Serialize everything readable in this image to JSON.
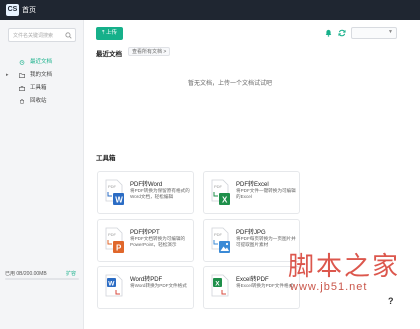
{
  "app": {
    "logo": "CS",
    "title": "首页"
  },
  "sidebar": {
    "search_placeholder": "文件名关键词搜索",
    "items": [
      {
        "label": "最近文档",
        "active": true,
        "icon": "clock-icon"
      },
      {
        "label": "我的文档",
        "active": false,
        "icon": "folder-icon",
        "caret": "▸"
      },
      {
        "label": "工具箱",
        "active": false,
        "icon": "toolbox-icon"
      },
      {
        "label": "回收站",
        "active": false,
        "icon": "trash-icon"
      }
    ],
    "storage_text": "已用 0B/200.00MB",
    "storage_fraction": 0.0,
    "expand_label": "扩容"
  },
  "toolbar": {
    "upload_label": "上传"
  },
  "recent": {
    "title": "最近文档",
    "view_all": "查看所有文档 >",
    "empty_message": "暂无文档，上传一个文档试试吧"
  },
  "tools": {
    "title": "工具箱",
    "cards": [
      {
        "title": "PDF转Word",
        "desc": "将PDF转换为保留原有格式的Word文档，轻松编辑",
        "badge": "W",
        "badge_color": "#2b6cc4"
      },
      {
        "title": "PDF转Excel",
        "desc": "将PDF文件一键转换为可编辑的Excel",
        "badge": "X",
        "badge_color": "#1e8f4a"
      },
      {
        "title": "PDF转PPT",
        "desc": "将PDF文档转换为可编辑的PowerPoint，轻松演示",
        "badge": "P",
        "badge_color": "#e0672b"
      },
      {
        "title": "PDF转JPG",
        "desc": "将PDF每页转换为一页图片并可提取图片素材",
        "badge": "img",
        "badge_color": "#3a8ad6"
      },
      {
        "title": "Word转PDF",
        "desc": "将Word转换为PDF文件格式",
        "badge": "W",
        "badge_color": "#2b6cc4"
      },
      {
        "title": "Excel转PDF",
        "desc": "将Excel转换为PDF文件格式",
        "badge": "X",
        "badge_color": "#1e8f4a"
      }
    ]
  },
  "help": {
    "label": "?"
  },
  "watermark": {
    "name": "脚本之家",
    "url": "www.jb51.net"
  },
  "colors": {
    "accent": "#16b08a",
    "titlebar": "#1f2631",
    "sidebar": "#f4f5f7"
  }
}
